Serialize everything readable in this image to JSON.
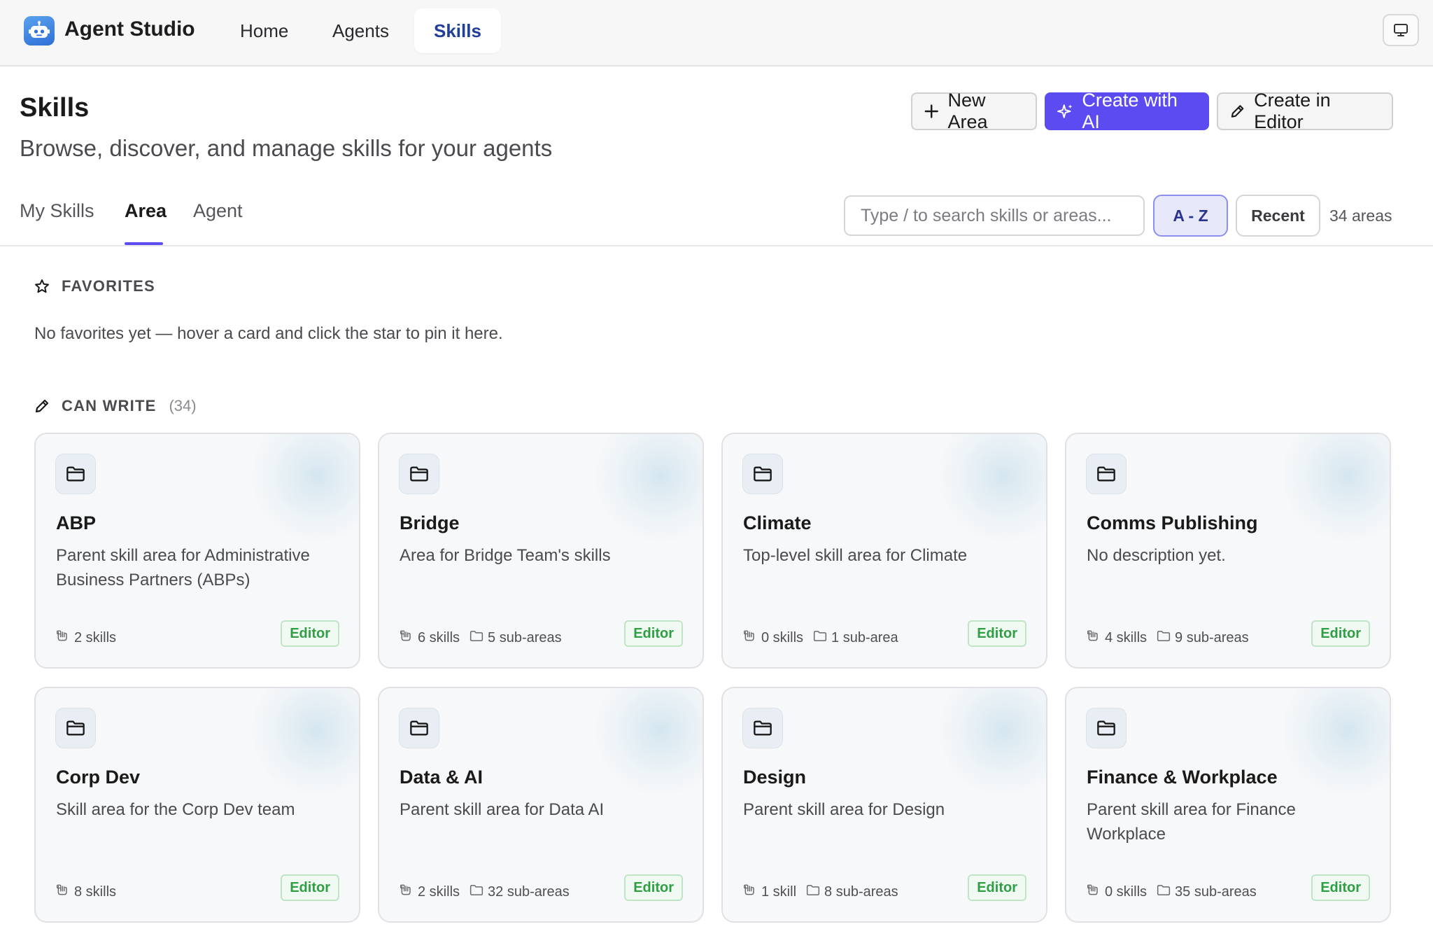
{
  "app": {
    "title": "Agent Studio"
  },
  "nav": {
    "items": [
      {
        "label": "Home",
        "active": false
      },
      {
        "label": "Agents",
        "active": false
      },
      {
        "label": "Skills",
        "active": true
      }
    ]
  },
  "header": {
    "title": "Skills",
    "subtitle": "Browse, discover, and manage skills for your agents",
    "buttons": {
      "new_area": "New Area",
      "create_ai": "Create with AI",
      "create_editor": "Create in Editor"
    }
  },
  "tabs": [
    {
      "label": "My Skills",
      "active": false
    },
    {
      "label": "Area",
      "active": true
    },
    {
      "label": "Agent",
      "active": false
    }
  ],
  "search": {
    "placeholder": "Type / to search skills or areas...",
    "value": ""
  },
  "sort": {
    "az": "A - Z",
    "recent": "Recent",
    "active": "A - Z"
  },
  "area_count": "34 areas",
  "favorites": {
    "title": "FAVORITES",
    "empty": "No favorites yet — hover a card and click the star to pin it here."
  },
  "can_write": {
    "title": "CAN WRITE",
    "count": "(34)",
    "cards": [
      {
        "title": "ABP",
        "desc": "Parent skill area for Administrative Business Partners (ABPs)",
        "skills": "2 skills",
        "subareas": "",
        "badge": "Editor"
      },
      {
        "title": "Bridge",
        "desc": "Area for Bridge Team's skills",
        "skills": "6 skills",
        "subareas": "5 sub-areas",
        "badge": "Editor"
      },
      {
        "title": "Climate",
        "desc": "Top-level skill area for Climate",
        "skills": "0 skills",
        "subareas": "1 sub-area",
        "badge": "Editor"
      },
      {
        "title": "Comms Publishing",
        "desc": "No description yet.",
        "skills": "4 skills",
        "subareas": "9 sub-areas",
        "badge": "Editor"
      },
      {
        "title": "Corp Dev",
        "desc": "Skill area for the Corp Dev team",
        "skills": "8 skills",
        "subareas": "",
        "badge": "Editor"
      },
      {
        "title": "Data & AI",
        "desc": "Parent skill area for Data AI",
        "skills": "2 skills",
        "subareas": "32 sub-areas",
        "badge": "Editor"
      },
      {
        "title": "Design",
        "desc": "Parent skill area for Design",
        "skills": "1 skill",
        "subareas": "8 sub-areas",
        "badge": "Editor"
      },
      {
        "title": "Finance & Workplace",
        "desc": "Parent skill area for Finance Workplace",
        "skills": "0 skills",
        "subareas": "35 sub-areas",
        "badge": "Editor"
      }
    ]
  },
  "icons": {
    "logo": "robot-icon",
    "display": "monitor-icon",
    "favorites": "star-icon",
    "can_write": "pencil-icon",
    "card": "folder-icon",
    "skills": "hand-icon",
    "subareas": "folder-icon"
  },
  "colors": {
    "accent": "#5b4bf0",
    "nav_active": "#1f3f9a",
    "badge_green": "#2f9e44"
  }
}
